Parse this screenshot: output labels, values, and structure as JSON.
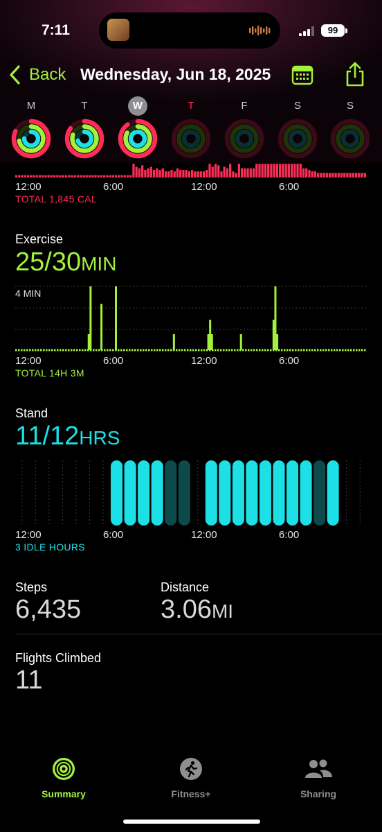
{
  "status_bar": {
    "time": "7:11",
    "battery": "99"
  },
  "nav": {
    "back_label": "Back",
    "title": "Wednesday, Jun 18, 2025"
  },
  "week": {
    "days": [
      "M",
      "T",
      "W",
      "T",
      "F",
      "S",
      "S"
    ],
    "selected_index": 2,
    "today_index": 3,
    "rings": [
      {
        "move": 0.82,
        "exercise": 0.72,
        "stand": 0.75
      },
      {
        "move": 0.85,
        "exercise": 0.8,
        "stand": 0.7
      },
      {
        "move": 0.9,
        "exercise": 0.83,
        "stand": 0.92
      },
      {
        "move": 0,
        "exercise": 0,
        "stand": 0
      },
      {
        "move": 0,
        "exercise": 0,
        "stand": 0
      },
      {
        "move": 0,
        "exercise": 0,
        "stand": 0
      },
      {
        "move": 0,
        "exercise": 0,
        "stand": 0
      }
    ]
  },
  "move_chart": {
    "x_labels": [
      "12:00",
      "6:00",
      "12:00",
      "6:00"
    ],
    "total": "TOTAL 1,845 CAL"
  },
  "exercise": {
    "title": "Exercise",
    "value": "25/30",
    "unit": "MIN",
    "y_max_label": "4 MIN",
    "x_labels": [
      "12:00",
      "6:00",
      "12:00",
      "6:00"
    ],
    "total": "TOTAL 14H 3M"
  },
  "stand": {
    "title": "Stand",
    "value": "11/12",
    "unit": "HRS",
    "x_labels": [
      "12:00",
      "6:00",
      "12:00",
      "6:00"
    ],
    "total": "3 IDLE HOURS"
  },
  "metrics": {
    "steps_label": "Steps",
    "steps_value": "6,435",
    "distance_label": "Distance",
    "distance_value": "3.06",
    "distance_unit": "MI",
    "flights_label": "Flights Climbed",
    "flights_value": "11"
  },
  "tabs": [
    {
      "label": "Summary",
      "active": true
    },
    {
      "label": "Fitness+",
      "active": false
    },
    {
      "label": "Sharing",
      "active": false
    }
  ],
  "colors": {
    "move": "#ff2d55",
    "exercise": "#a3f23a",
    "stand": "#1de0e6",
    "back": "#a3f23a"
  },
  "chart_data": [
    {
      "type": "bar",
      "x_labels": [
        "12:00",
        "6:00",
        "12:00",
        "6:00"
      ],
      "annotation": "TOTAL 1,845 CAL",
      "series": [
        {
          "values": [
            0.15,
            0.15,
            0.15,
            0.15,
            0.15,
            0.15,
            0.15,
            0.15,
            0.15,
            0.15,
            0.15,
            0.15,
            0.15,
            0.15,
            0.15,
            0.15,
            0.15,
            0.15,
            0.15,
            0.15,
            0.15,
            0.15,
            0.15,
            0.15,
            0.15,
            0.15,
            0.15,
            0.15,
            0.15,
            0.15,
            0.15,
            0.15,
            0.15,
            0.15,
            0.15,
            0.15,
            0.15,
            0.15,
            0.15,
            0.15,
            0.9,
            0.7,
            0.6,
            0.8,
            0.5,
            0.6,
            0.7,
            0.5,
            0.6,
            0.5,
            0.6,
            0.4,
            0.4,
            0.5,
            0.4,
            0.6,
            0.5,
            0.5,
            0.5,
            0.4,
            0.5,
            0.4,
            0.4,
            0.4,
            0.4,
            0.5,
            0.9,
            0.7,
            0.9,
            0.8,
            0.4,
            0.7,
            0.6,
            0.9,
            0.4,
            0.3,
            0.9,
            0.6,
            0.6,
            0.6,
            0.6,
            0.6,
            0.9,
            0.9,
            0.9,
            0.9,
            0.9,
            0.9,
            0.9,
            0.9,
            0.9,
            0.9,
            0.9,
            0.9,
            0.9,
            0.9,
            0.9,
            0.9,
            0.6,
            0.6,
            0.5,
            0.4,
            0.4,
            0.3,
            0.3,
            0.3,
            0.3,
            0.3,
            0.3,
            0.3,
            0.3,
            0.3,
            0.3,
            0.3,
            0.3,
            0.3,
            0.3,
            0.3,
            0.3,
            0.3
          ]
        }
      ]
    },
    {
      "type": "bar",
      "ylabel": "4 MIN",
      "x_labels": [
        "12:00",
        "6:00",
        "12:00",
        "6:00"
      ],
      "annotation": "TOTAL 14H 3M",
      "series": [
        {
          "values": [
            0,
            0,
            0,
            0,
            0,
            0,
            0,
            0,
            0,
            0,
            0,
            0,
            0,
            0,
            0,
            0,
            0,
            0,
            0,
            0,
            0,
            0,
            0,
            0,
            0,
            0,
            0,
            0,
            0,
            0,
            0,
            0,
            0,
            0,
            0,
            0,
            0,
            0,
            0,
            0,
            1.0,
            4.0,
            0,
            0,
            0,
            0,
            0,
            2.9,
            0,
            0,
            0,
            0,
            0,
            0,
            0,
            4.0,
            0,
            0,
            0,
            0,
            0,
            0,
            0,
            0,
            0,
            0,
            0,
            0,
            0,
            0,
            0,
            0,
            0,
            0,
            0,
            0,
            0,
            0,
            0,
            0,
            0,
            0,
            0,
            0,
            0,
            0,
            0,
            1.0,
            0,
            0,
            0,
            0,
            0,
            0,
            0,
            0,
            0,
            0,
            0,
            0,
            0,
            0,
            0,
            0,
            0,
            0,
            1.0,
            1.9,
            1.0,
            0,
            0,
            0,
            0,
            0,
            0,
            0,
            0,
            0,
            0,
            0,
            0,
            0,
            0,
            0,
            1.0,
            0,
            0,
            0,
            0,
            0,
            0,
            0,
            0,
            0,
            0,
            0,
            0,
            0,
            0,
            0,
            0,
            0,
            1.9,
            4.0,
            1.0,
            0,
            0,
            0,
            0,
            0,
            0,
            0,
            0,
            0,
            0,
            0,
            0,
            0,
            0,
            0,
            0,
            0,
            0,
            0,
            0,
            0,
            0,
            0,
            0,
            0,
            0,
            0,
            0,
            0,
            0,
            0,
            0,
            0,
            0,
            0,
            0,
            0,
            0,
            0,
            0,
            0,
            0,
            0,
            0,
            0,
            0,
            0,
            0,
            0
          ]
        }
      ]
    },
    {
      "type": "bar",
      "x_labels": [
        "12:00",
        "6:00",
        "12:00",
        "6:00"
      ],
      "annotation": "3 IDLE HOURS",
      "series": [
        {
          "values": [
            0,
            0,
            0,
            0,
            0,
            0,
            0,
            1,
            1,
            1,
            1,
            -1,
            -1,
            0,
            1,
            1,
            1,
            1,
            1,
            1,
            1,
            1,
            -1,
            1,
            0,
            0
          ]
        }
      ]
    }
  ]
}
